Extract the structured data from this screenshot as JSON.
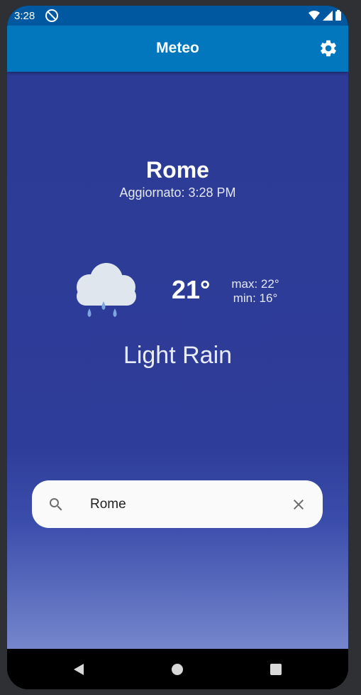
{
  "status_bar": {
    "time": "3:28"
  },
  "app_bar": {
    "title": "Meteo"
  },
  "weather": {
    "city": "Rome",
    "updated": "Aggiornato: 3:28 PM",
    "temperature": "21°",
    "max": "max: 22°",
    "min": "min: 16°",
    "condition": "Light Rain",
    "icon": "cloud-rain-icon"
  },
  "search": {
    "value": "Rome"
  },
  "colors": {
    "app_bar": "#0277bd",
    "status_bar": "#0059a0",
    "background_top": "#2c3b95",
    "background_bottom": "#7586cc"
  }
}
